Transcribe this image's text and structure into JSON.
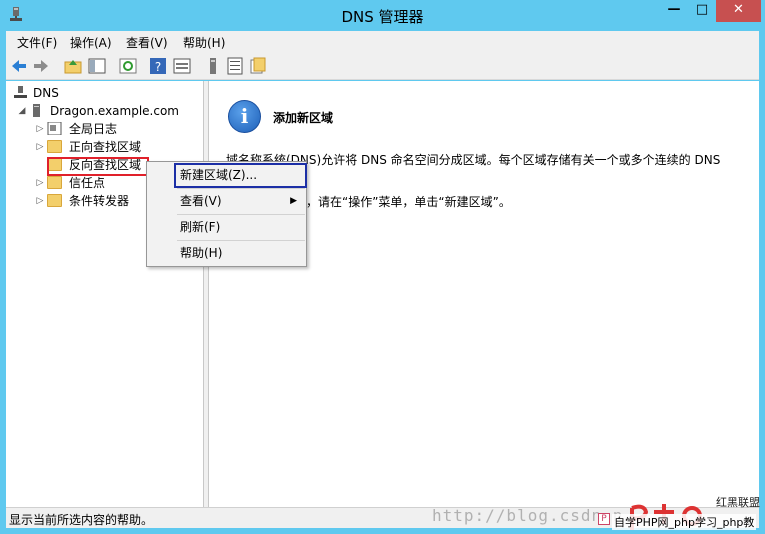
{
  "window": {
    "title": "DNS 管理器"
  },
  "menubar": {
    "file": "文件(F)",
    "action": "操作(A)",
    "view": "查看(V)",
    "help": "帮助(H)"
  },
  "tree": {
    "root": "DNS",
    "server": "Dragon.example.com",
    "children": [
      "全局日志",
      "正向查找区域",
      "反向查找区域",
      "信任点",
      "条件转发器"
    ]
  },
  "main": {
    "heading": "添加新区域",
    "description": "域名称系统(DNS)允许将 DNS 命名空间分成区域。每个区域存储有关一个或多个连续的 DNS",
    "instruction": "域，请在“操作”菜单，单击“新建区域”。"
  },
  "context_menu": {
    "items": [
      "新建区域(Z)...",
      "查看(V)",
      "刷新(F)",
      "帮助(H)"
    ]
  },
  "statusbar": {
    "text": "显示当前所选内容的帮助。"
  },
  "watermark": {
    "text": "http://blog.csdn.n",
    "logo_text": "自学PHP网_php学习_php教",
    "logo_badge": "红黑联盟"
  },
  "colors": {
    "titlebar": "#5fc9ef",
    "close_button": "#c75050",
    "highlight_red": "#e0202a",
    "highlight_blue": "#1c2fa6"
  }
}
